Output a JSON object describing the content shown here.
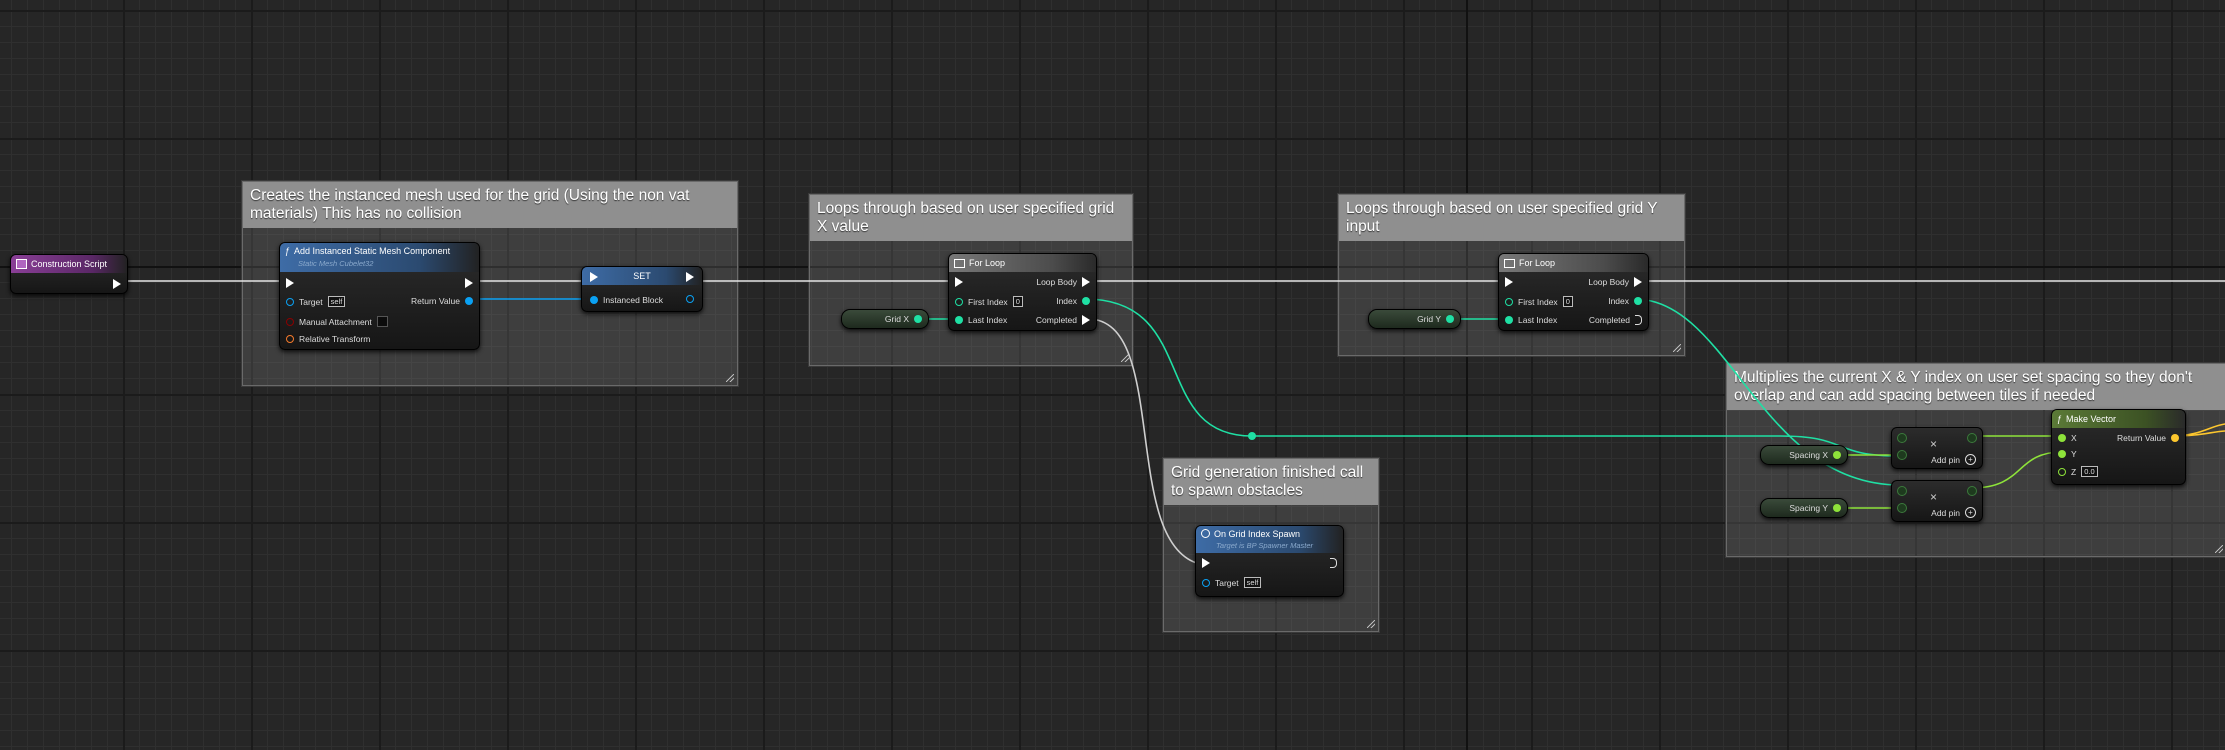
{
  "comments": {
    "mesh": "Creates the instanced mesh used for the grid (Using the non vat materials) This has no collision",
    "loop_x": "Loops through based on user specified grid X value",
    "loop_y": "Loops through based on user specified grid Y input",
    "spawn": "Grid generation finished call to spawn obstacles",
    "multiply": "Multiplies the current X & Y index on user set spacing so they don't overlap and can add spacing between tiles if needed"
  },
  "nodes": {
    "construction_script": "Construction Script",
    "add_ism": {
      "title": "Add Instanced Static Mesh Component",
      "subtitle": "Static Mesh Cubelet32",
      "target": "Target",
      "target_val": "self",
      "return_value": "Return Value",
      "manual_attachment": "Manual Attachment",
      "relative_transform": "Relative Transform"
    },
    "set": {
      "title": "SET",
      "instanced_block": "Instanced Block"
    },
    "for_loop_x": {
      "title": "For Loop",
      "first_index": "First Index",
      "first_val": "0",
      "last_index": "Last Index",
      "loop_body": "Loop Body",
      "index": "Index",
      "completed": "Completed"
    },
    "for_loop_y": {
      "title": "For Loop",
      "first_index": "First Index",
      "first_val": "0",
      "last_index": "Last Index",
      "loop_body": "Loop Body",
      "index": "Index",
      "completed": "Completed"
    },
    "grid_x": "Grid X",
    "grid_y": "Grid Y",
    "on_grid_spawn": {
      "title": "On Grid Index Spawn",
      "subtitle": "Target is BP Spawner Master",
      "target": "Target",
      "target_val": "self"
    },
    "spacing_x": "Spacing X",
    "spacing_y": "Spacing Y",
    "multiply_1": {
      "symbol": "×",
      "add_pin": "Add pin"
    },
    "multiply_2": {
      "symbol": "×",
      "add_pin": "Add pin"
    },
    "make_vector": {
      "title": "Make Vector",
      "x": "X",
      "y": "Y",
      "z": "Z",
      "z_val": "0.0",
      "return_value": "Return Value"
    }
  },
  "colors": {
    "exec": "#ffffff",
    "object": "#0aa1f3",
    "integer": "#1fe0a4",
    "float": "#8ee33a",
    "vector": "#fdc72e",
    "transform": "#f57a2b",
    "bool": "#8b0000"
  }
}
